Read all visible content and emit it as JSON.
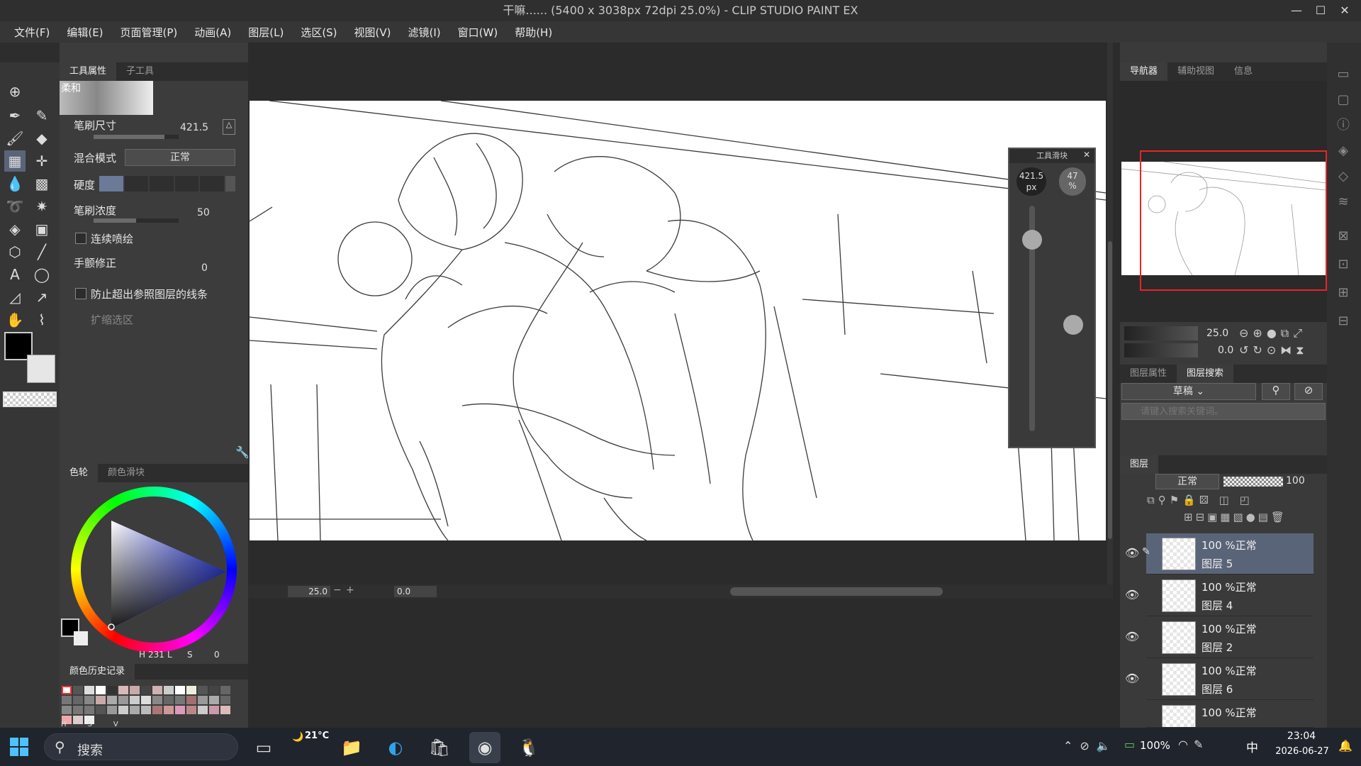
{
  "title": "干嘛...... (5400 x 3038px 72dpi 25.0%)  - CLIP STUDIO PAINT EX",
  "window_controls": {
    "minimize": "—",
    "maximize": "☐",
    "close": "✕"
  },
  "menu": [
    "文件(F)",
    "编辑(E)",
    "页面管理(P)",
    "动画(A)",
    "图层(L)",
    "选区(S)",
    "视图(V)",
    "滤镜(I)",
    "窗口(W)",
    "帮助(H)"
  ],
  "tool_property": {
    "tab_active": "工具属性",
    "tab_inactive": "子工具",
    "brush_name": "柔和",
    "brush_size_label": "笔刷尺寸",
    "brush_size_value": "421.5",
    "blend_label": "混合模式",
    "blend_value": "正常",
    "hardness_label": "硬度",
    "density_label": "笔刷浓度",
    "density_value": "50",
    "continuous_label": "连续喷绘",
    "stabilize_label": "手颤修正",
    "stabilize_value": "0",
    "prevent_label": "防止超出参照图层的线条",
    "expand_label": "扩缩选区"
  },
  "color_panel": {
    "tab_active": "色轮",
    "tab_inactive": "颜色滑块",
    "h_label": "H",
    "h_value": "231",
    "l_label": "L",
    "s_label": "S",
    "v_value": "0"
  },
  "history_panel": {
    "title": "颜色历史记录",
    "hsv_labels": [
      "H",
      "S",
      "V"
    ]
  },
  "canvas_status": {
    "zoom": "25.0",
    "angle": "0.0"
  },
  "slider_popup": {
    "title": "工具滑块",
    "size_value": "421.5",
    "size_unit": "px",
    "density_value": "47",
    "density_unit": "%",
    "size_level": 0.85,
    "density_level": 0.47
  },
  "navigator": {
    "tab_active": "导航器",
    "tab2": "辅助视图",
    "tab3": "信息",
    "zoom": "25.0",
    "angle": "0.0"
  },
  "layer_search": {
    "tab_inactive": "图层属性",
    "tab_active": "图层搜索",
    "filter_value": "草稿",
    "placeholder": "请键入搜索关键词。"
  },
  "layer_panel": {
    "title": "图层",
    "blend": "正常",
    "opacity": "100",
    "layers": [
      {
        "mode": "100 %正常",
        "name": "图层 5",
        "selected": true
      },
      {
        "mode": "100 %正常",
        "name": "图层 4",
        "selected": false
      },
      {
        "mode": "100 %正常",
        "name": "图层 2",
        "selected": false
      },
      {
        "mode": "100 %正常",
        "name": "图层 6",
        "selected": false
      },
      {
        "mode": "100 %正常",
        "name": "",
        "selected": false
      }
    ]
  },
  "taskbar": {
    "search_label": "搜索",
    "weather": "21°C",
    "battery": "100%",
    "ime": "中",
    "time": "23:04",
    "date": "2026-06-27"
  },
  "colors": {
    "accent": "#5a6479",
    "panel": "#3c3c3c",
    "canvas_bg": "#2b2b2b",
    "taskbar": "#20242c"
  }
}
